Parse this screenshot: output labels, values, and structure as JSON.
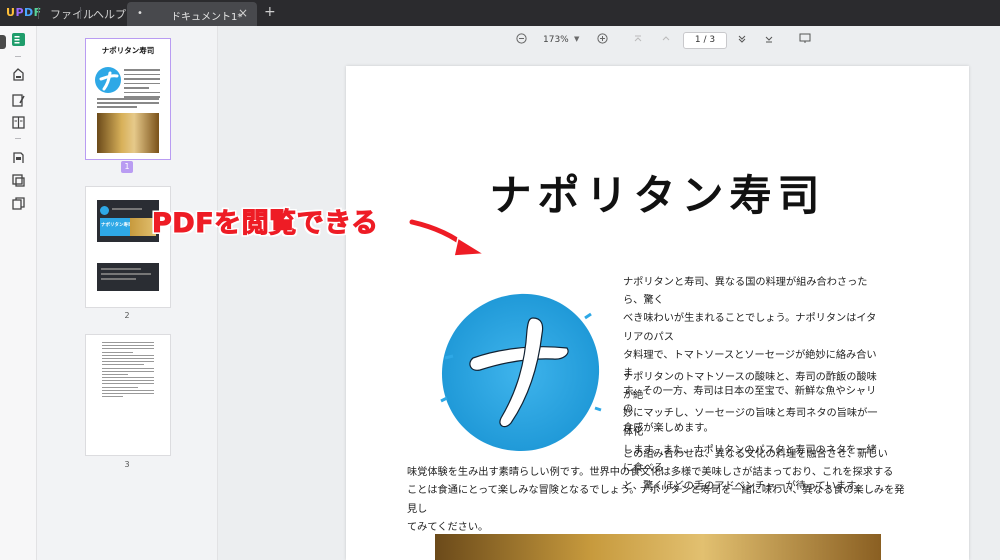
{
  "app": {
    "logo": "UPDF"
  },
  "menu": {
    "file": "ファイル",
    "help": "ヘルプ"
  },
  "tab": {
    "dot": "•",
    "name": "ドキュメント1*",
    "close": "×",
    "new": "+"
  },
  "nav": {
    "zoom": "173%",
    "page_indicator": "1 / 3"
  },
  "thumbnails": [
    {
      "number": "1",
      "selected": true
    },
    {
      "number": "2",
      "selected": false
    },
    {
      "number": "3",
      "selected": false
    }
  ],
  "thumb1": {
    "title": "ナポリタン寿司"
  },
  "thumb2": {
    "text": "ナポリタン寿司"
  },
  "annotation": {
    "text": "PDFを閲覧できる",
    "color": "#ee1c25"
  },
  "document": {
    "title": "ナポリタン寿司",
    "paragraph1": [
      "ナポリタンと寿司、異なる国の料理が組み合わさったら、驚く",
      "べき味わいが生まれることでしょう。ナポリタンはイタリアのパス",
      "タ料理で、トマトソースとソーセージが絶妙に絡み合いま",
      "す。その一方、寿司は日本の至宝で、新鮮な魚やシャリの",
      "食感が楽しめます。"
    ],
    "paragraph2": [
      "ナポリタンのトマトソースの酸味と、寿司の酢飯の酸味が絶",
      "妙にマッチし、ソーセージの旨味と寿司ネタの旨味が一体化",
      "します。また、ナポリタンのパスタと寿司のネタを一緒に食べる",
      "と、驚くほどの舌のアドベンチャーが待っています。"
    ],
    "paragraph3": [
      "この組み合わせは、異なる文化の料理を融合させ、新しい",
      "味覚体験を生み出す素晴らしい例です。世界中の食文化は多様で美味しさが詰まっており、これを探求する",
      "ことは食通にとって楽しみな冒険となるでしょう。ナポリタンと寿司を一緒に味わい、異なる食の楽しみを発見し",
      "てみてください。"
    ],
    "logo_glyph": "ナ"
  },
  "colors": {
    "accent": "#b99cf2",
    "logo_blue": "#2ea8e6"
  }
}
